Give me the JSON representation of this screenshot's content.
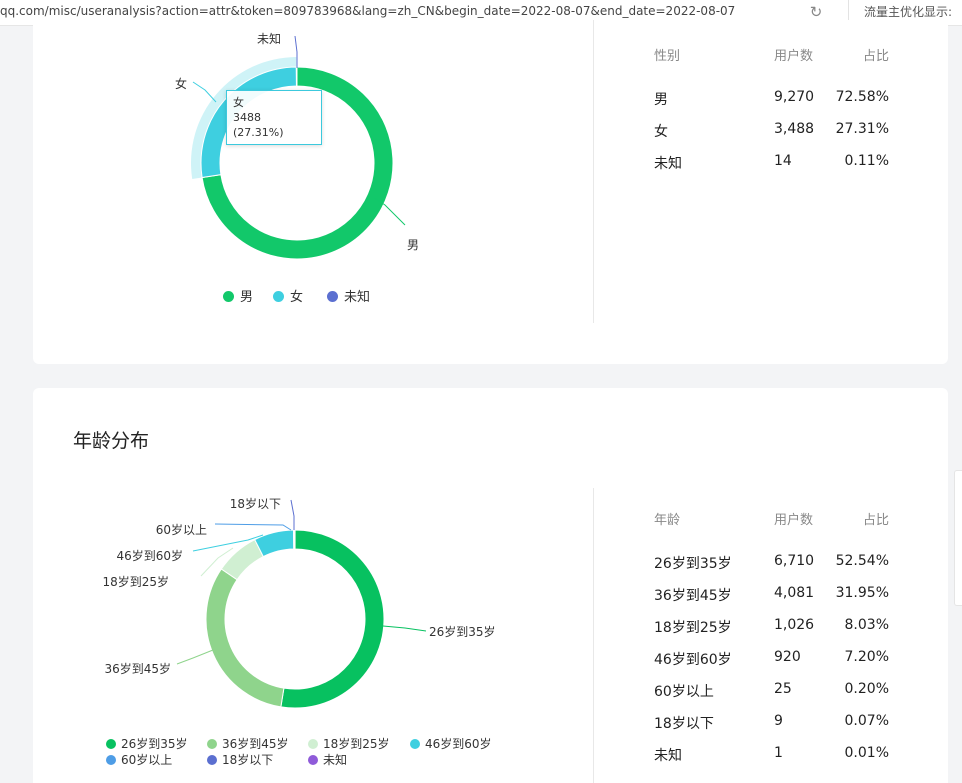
{
  "browser": {
    "url": "qq.com/misc/useranalysis?action=attr&token=809783968&lang=zh_CN&begin_date=2022-08-07&end_date=2022-08-07",
    "notice": "流量主优化显示:"
  },
  "gender_section": {
    "tooltip": {
      "label": "女",
      "value": "3488 (27.31%)"
    },
    "slice_labels": [
      "男",
      "女",
      "未知"
    ],
    "legend": [
      {
        "label": "男",
        "color": "#12c86a"
      },
      {
        "label": "女",
        "color": "#3ecfe0"
      },
      {
        "label": "未知",
        "color": "#5b6fd0"
      }
    ],
    "table": {
      "headers": [
        "性别",
        "用户数",
        "占比"
      ],
      "rows": [
        [
          "男",
          "9,270",
          "72.58%"
        ],
        [
          "女",
          "3,488",
          "27.31%"
        ],
        [
          "未知",
          "14",
          "0.11%"
        ]
      ]
    }
  },
  "age_section": {
    "title": "年龄分布",
    "slice_labels": [
      "26岁到35岁",
      "36岁到45岁",
      "18岁到25岁",
      "46岁到60岁",
      "60岁以上",
      "18岁以下"
    ],
    "legend": [
      {
        "label": "26岁到35岁",
        "color": "#07c160"
      },
      {
        "label": "36岁到45岁",
        "color": "#8fd48c"
      },
      {
        "label": "18岁到25岁",
        "color": "#d0efd2"
      },
      {
        "label": "46岁到60岁",
        "color": "#3ecfe0"
      },
      {
        "label": "60岁以上",
        "color": "#4e9de6"
      },
      {
        "label": "18岁以下",
        "color": "#5b6fd0"
      },
      {
        "label": "未知",
        "color": "#8f5bd9"
      }
    ],
    "table": {
      "headers": [
        "年龄",
        "用户数",
        "占比"
      ],
      "rows": [
        [
          "26岁到35岁",
          "6,710",
          "52.54%"
        ],
        [
          "36岁到45岁",
          "4,081",
          "31.95%"
        ],
        [
          "18岁到25岁",
          "1,026",
          "8.03%"
        ],
        [
          "46岁到60岁",
          "920",
          "7.20%"
        ],
        [
          "60岁以上",
          "25",
          "0.20%"
        ],
        [
          "18岁以下",
          "9",
          "0.07%"
        ],
        [
          "未知",
          "1",
          "0.01%"
        ]
      ]
    }
  },
  "chart_data": [
    {
      "type": "pie",
      "categories": [
        "男",
        "女",
        "未知"
      ],
      "values": [
        9270,
        3488,
        14
      ],
      "colors": [
        "#12c86a",
        "#3ecfe0",
        "#5b6fd0"
      ],
      "highlighted": "女",
      "legend": "bottom"
    },
    {
      "type": "pie",
      "categories": [
        "26岁到35岁",
        "36岁到45岁",
        "18岁到25岁",
        "46岁到60岁",
        "60岁以上",
        "18岁以下",
        "未知"
      ],
      "values": [
        6710,
        4081,
        1026,
        920,
        25,
        9,
        1
      ],
      "colors": [
        "#07c160",
        "#8fd48c",
        "#d0efd2",
        "#3ecfe0",
        "#4e9de6",
        "#5b6fd0",
        "#8f5bd9"
      ],
      "legend": "bottom"
    }
  ]
}
